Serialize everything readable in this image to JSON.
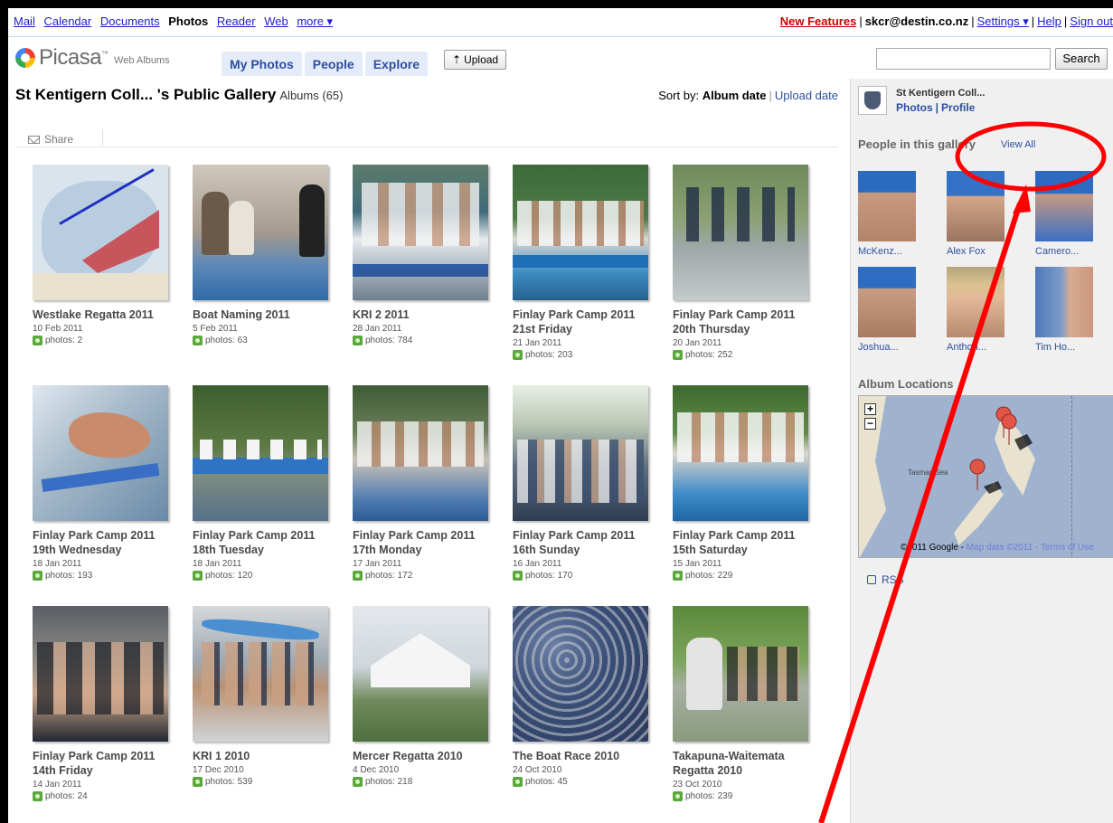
{
  "gbar": {
    "links": [
      "Mail",
      "Calendar",
      "Documents"
    ],
    "current": "Photos",
    "links2": [
      "Reader",
      "Web"
    ],
    "more": "more ▾"
  },
  "guser": {
    "new_features": "New Features",
    "email": "skcr@destin.co.nz",
    "settings": "Settings ▾",
    "help": "Help",
    "signout": "Sign out"
  },
  "header": {
    "logo_word": "Picasa",
    "logo_tm": "™",
    "logo_sub": "Web Albums",
    "tabs": [
      "My Photos",
      "People",
      "Explore"
    ],
    "upload": "Upload",
    "search_btn": "Search",
    "search_value": ""
  },
  "gallery": {
    "title": "St Kentigern Coll... 's Public Gallery",
    "count": "Albums (65)",
    "sort_label": "Sort by:",
    "sort_active": "Album date",
    "sort_other": "Upload date",
    "share": "Share"
  },
  "albums": [
    {
      "name": "Westlake Regatta 2011",
      "date": "10 Feb 2011",
      "count": "photos: 2"
    },
    {
      "name": "Boat Naming 2011",
      "date": "5 Feb 2011",
      "count": "photos: 63"
    },
    {
      "name": "KRI 2 2011",
      "date": "28 Jan 2011",
      "count": "photos: 784"
    },
    {
      "name": "Finlay Park Camp 2011 21st Friday",
      "date": "21 Jan 2011",
      "count": "photos: 203"
    },
    {
      "name": "Finlay Park Camp 2011 20th Thursday",
      "date": "20 Jan 2011",
      "count": "photos: 252"
    },
    {
      "name": "Finlay Park Camp 2011 19th Wednesday",
      "date": "18 Jan 2011",
      "count": "photos: 193"
    },
    {
      "name": "Finlay Park Camp 2011 18th Tuesday",
      "date": "18 Jan 2011",
      "count": "photos: 120"
    },
    {
      "name": "Finlay Park Camp 2011 17th Monday",
      "date": "17 Jan 2011",
      "count": "photos: 172"
    },
    {
      "name": "Finlay Park Camp 2011 16th Sunday",
      "date": "16 Jan 2011",
      "count": "photos: 170"
    },
    {
      "name": "Finlay Park Camp 2011 15th Saturday",
      "date": "15 Jan 2011",
      "count": "photos: 229"
    },
    {
      "name": "Finlay Park Camp 2011 14th Friday",
      "date": "14 Jan 2011",
      "count": "photos: 24"
    },
    {
      "name": "KRI 1 2010",
      "date": "17 Dec 2010",
      "count": "photos: 539"
    },
    {
      "name": "Mercer Regatta 2010",
      "date": "4 Dec 2010",
      "count": "photos: 218"
    },
    {
      "name": "The Boat Race 2010",
      "date": "24 Oct 2010",
      "count": "photos: 45"
    },
    {
      "name": "Takapuna-Waitemata Regatta 2010",
      "date": "23 Oct 2010",
      "count": "photos: 239"
    }
  ],
  "sidebar": {
    "owner": "St Kentigern Coll...",
    "photos_link": "Photos",
    "profile_link": "Profile",
    "people_heading": "People in this gallery",
    "view_all": "View All",
    "people": [
      "McKenz...",
      "Alex Fox",
      "Camero...",
      "Joshua...",
      "Anthon...",
      "Tim Ho..."
    ],
    "location_heading": "Album Locations",
    "map_label": "Tasman Sea",
    "map_copyright": "©2011 Google -",
    "map_data": "Map data ©2011",
    "map_terms": "- Terms of Use",
    "rss": "RSS"
  },
  "colors": {
    "link": "#2d4fa0",
    "tab_bg": "#e5ecf9",
    "annotation": "#ff0000"
  }
}
